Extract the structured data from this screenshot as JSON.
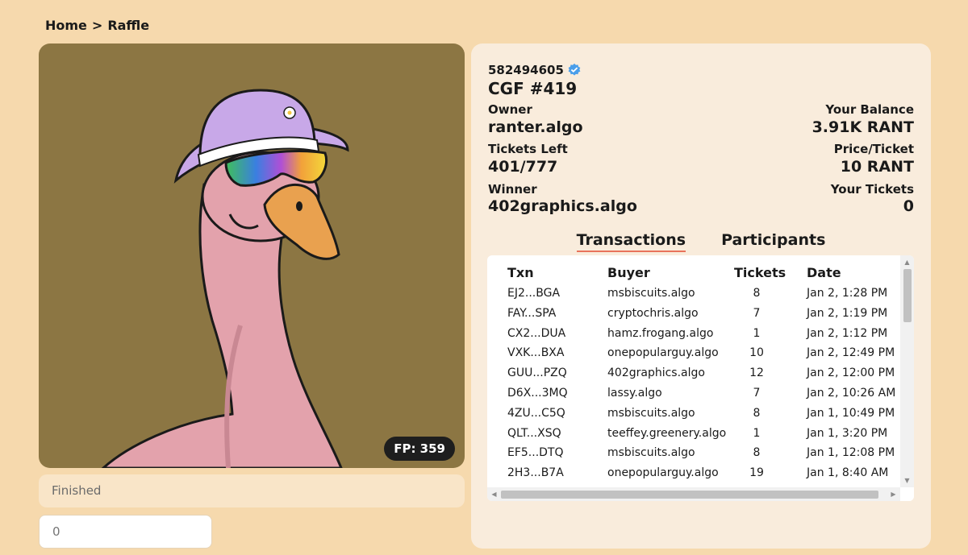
{
  "breadcrumb": {
    "home": "Home",
    "separator": ">",
    "current": "Raffle"
  },
  "artwork": {
    "floor_price_badge": "FP: 359",
    "background_color": "#8c7643"
  },
  "status": {
    "text": "Finished"
  },
  "ticket_input": {
    "placeholder": "0"
  },
  "details": {
    "asset_id": "582494605",
    "name": "CGF #419",
    "owner_label": "Owner",
    "owner_value": "ranter.algo",
    "balance_label": "Your Balance",
    "balance_value": "3.91K RANT",
    "tickets_left_label": "Tickets Left",
    "tickets_left_value": "401/777",
    "price_label": "Price/Ticket",
    "price_value": "10 RANT",
    "winner_label": "Winner",
    "winner_value": "402graphics.algo",
    "your_tickets_label": "Your Tickets",
    "your_tickets_value": "0"
  },
  "tabs": [
    {
      "label": "Transactions",
      "active": true
    },
    {
      "label": "Participants",
      "active": false
    }
  ],
  "transactions": {
    "headers": {
      "txn": "Txn",
      "buyer": "Buyer",
      "tickets": "Tickets",
      "date": "Date"
    },
    "rows": [
      {
        "txn": "EJ2...BGA",
        "buyer": "msbiscuits.algo",
        "tickets": "8",
        "date": "Jan 2, 1:28 PM"
      },
      {
        "txn": "FAY...SPA",
        "buyer": "cryptochris.algo",
        "tickets": "7",
        "date": "Jan 2, 1:19 PM"
      },
      {
        "txn": "CX2...DUA",
        "buyer": "hamz.frogang.algo",
        "tickets": "1",
        "date": "Jan 2, 1:12 PM"
      },
      {
        "txn": "VXK...BXA",
        "buyer": "onepopularguy.algo",
        "tickets": "10",
        "date": "Jan 2, 12:49 PM"
      },
      {
        "txn": "GUU...PZQ",
        "buyer": "402graphics.algo",
        "tickets": "12",
        "date": "Jan 2, 12:00 PM"
      },
      {
        "txn": "D6X...3MQ",
        "buyer": "lassy.algo",
        "tickets": "7",
        "date": "Jan 2, 10:26 AM"
      },
      {
        "txn": "4ZU...C5Q",
        "buyer": "msbiscuits.algo",
        "tickets": "8",
        "date": "Jan 1, 10:49 PM"
      },
      {
        "txn": "QLT...XSQ",
        "buyer": "teeffey.greenery.algo",
        "tickets": "1",
        "date": "Jan 1, 3:20 PM"
      },
      {
        "txn": "EF5...DTQ",
        "buyer": "msbiscuits.algo",
        "tickets": "8",
        "date": "Jan 1, 12:08 PM"
      },
      {
        "txn": "2H3...B7A",
        "buyer": "onepopularguy.algo",
        "tickets": "19",
        "date": "Jan 1, 8:40 AM"
      }
    ]
  },
  "colors": {
    "page_bg": "#f6d9ad",
    "panel_bg": "#f9ecdc",
    "tab_underline": "#e8735b",
    "verified_blue": "#4a9eea"
  }
}
